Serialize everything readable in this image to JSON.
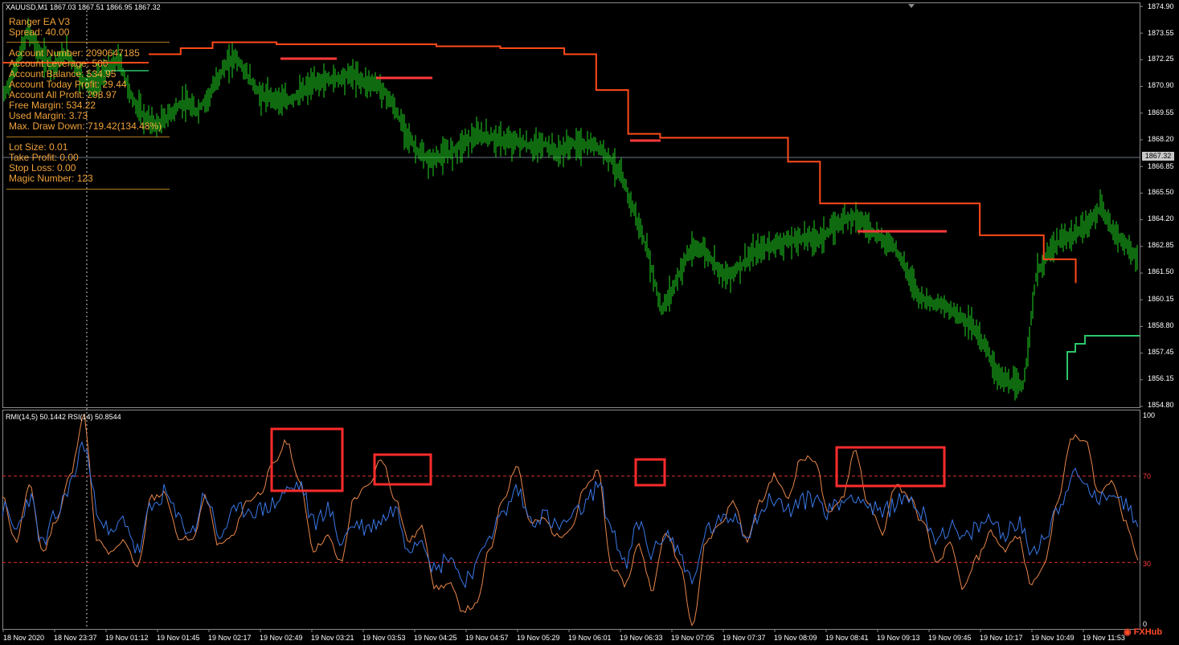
{
  "header": {
    "symbol_quote": "XAUUSD,M1  1867.03 1867.51 1866.95 1867.32",
    "indicator_legend": "RMI(14,5) 50.1442  RSI(14) 50.8544"
  },
  "ea_panel": {
    "title": "Ranger EA V3",
    "spread": "Spread: 40.00",
    "account_number": "Account Number: 2090647185",
    "account_leverage": "Account Leverage: 500",
    "account_balance": "Account Balance: 534.95",
    "account_today_profit": "Account Today Profit: 29.44",
    "account_all_profit": "Account All Profit: 298.97",
    "free_margin": "Free Margin: 534.22",
    "used_margin": "Used Margin: 3.73",
    "max_draw_down": "Max. Draw Down: 719.42(134.48%)",
    "lot_size": "Lot Size: 0.01",
    "take_profit": "Take Profit: 0.00",
    "stop_loss": "Stop Loss: 0.00",
    "magic_number": "Magic Number: 123"
  },
  "price_axis": [
    "1874.90",
    "1873.55",
    "1872.25",
    "1870.90",
    "1869.55",
    "1868.20",
    "1866.85",
    "1865.50",
    "1864.20",
    "1862.85",
    "1861.50",
    "1860.15",
    "1858.80",
    "1857.45",
    "1856.15",
    "1854.80"
  ],
  "current_price_tag": "1867.32",
  "indicator_axis": {
    "max": "100",
    "upper": "70",
    "lower": "30",
    "min": "0"
  },
  "time_axis": [
    "18 Nov 2020",
    "18 Nov 23:37",
    "19 Nov 01:12",
    "19 Nov 01:45",
    "19 Nov 02:17",
    "19 Nov 02:49",
    "19 Nov 03:21",
    "19 Nov 03:53",
    "19 Nov 04:25",
    "19 Nov 04:57",
    "19 Nov 05:29",
    "19 Nov 06:01",
    "19 Nov 06:33",
    "19 Nov 07:05",
    "19 Nov 07:37",
    "19 Nov 08:09",
    "19 Nov 08:41",
    "19 Nov 09:13",
    "19 Nov 09:45",
    "19 Nov 10:17",
    "19 Nov 10:49",
    "19 Nov 11:53"
  ],
  "watermark": "FXHub",
  "colors": {
    "background": "#000000",
    "candles": "#1fd41f",
    "stop_line_orange": "#ff4a1a",
    "stop_line_green": "#2ec56a",
    "rsi_line": "#e8864a",
    "rmi_line": "#3a78e8",
    "level_line": "#e03030",
    "highlight_box": "#ff2b2b",
    "text_panel": "#f0a23a"
  },
  "chart_data": [
    {
      "type": "line",
      "title": "XAUUSD,M1",
      "ylim": [
        1854.8,
        1874.9
      ],
      "series": [
        {
          "name": "XAUUSD",
          "values": [
            1870.2,
            1871.8,
            1873.7,
            1872.4,
            1871.9,
            1872.6,
            1871.4,
            1870.9,
            1871.6,
            1872.3,
            1870.3,
            1869.3,
            1868.9,
            1869.5,
            1870.1,
            1869.6,
            1870.4,
            1871.7,
            1872.4,
            1871.4,
            1870.4,
            1870.3,
            1870.1,
            1870.5,
            1871.0,
            1871.2,
            1871.3,
            1871.5,
            1871.1,
            1871.0,
            1870.2,
            1868.9,
            1867.7,
            1867.1,
            1867.4,
            1867.7,
            1868.2,
            1868.4,
            1868.3,
            1868.1,
            1868.1,
            1867.8,
            1868.0,
            1867.5,
            1868.0,
            1867.9,
            1867.9,
            1867.3,
            1866.2,
            1864.4,
            1862.4,
            1859.6,
            1860.9,
            1862.4,
            1862.8,
            1862.1,
            1861.3,
            1861.8,
            1862.4,
            1862.8,
            1863.0,
            1863.1,
            1863.3,
            1863.2,
            1863.6,
            1864.2,
            1864.4,
            1863.8,
            1863.2,
            1862.9,
            1861.6,
            1860.3,
            1860.0,
            1859.8,
            1859.4,
            1858.9,
            1857.9,
            1856.4,
            1855.9,
            1855.8,
            1861.4,
            1862.6,
            1863.2,
            1863.4,
            1864.0,
            1864.8,
            1863.6,
            1862.9,
            1862.0
          ]
        },
        {
          "name": "Stop Line",
          "values": [
            1872.5,
            1872.8,
            1873.1,
            1873.1,
            1873.0,
            1873.0,
            1873.0,
            1873.0,
            1873.0,
            1872.9,
            1872.9,
            1872.8,
            1872.8,
            1872.5,
            1870.7,
            1868.5,
            1868.3,
            1868.3,
            1868.3,
            1868.3,
            1867.1,
            1865.0,
            1865.0,
            1865.0,
            1865.0,
            1865.0,
            1863.4,
            1863.4,
            1862.2,
            1861.0,
            1858.6,
            1858.6
          ]
        }
      ]
    },
    {
      "type": "line",
      "title": "RMI(14,5) RSI(14)",
      "ylim": [
        0,
        100
      ],
      "series": [
        {
          "name": "RMI(14,5)",
          "values": [
            55,
            45,
            60,
            38,
            52,
            66,
            85,
            55,
            42,
            50,
            35,
            55,
            62,
            50,
            44,
            62,
            42,
            52,
            55,
            54,
            57,
            63,
            66,
            48,
            55,
            40,
            48,
            46,
            50,
            55,
            38,
            42,
            26,
            34,
            22,
            28,
            44,
            52,
            64,
            50,
            52,
            46,
            50,
            56,
            66,
            46,
            28,
            48,
            34,
            44,
            35,
            20,
            45,
            48,
            52,
            44,
            54,
            60,
            54,
            58,
            60,
            54,
            58,
            62,
            56,
            52,
            58,
            60,
            52,
            42,
            46,
            40,
            46,
            50,
            44,
            48,
            36,
            42,
            56,
            70,
            66,
            58,
            64,
            56,
            50
          ]
        },
        {
          "name": "RSI(14)",
          "values": [
            60,
            40,
            65,
            35,
            50,
            70,
            98,
            40,
            34,
            40,
            28,
            60,
            62,
            42,
            40,
            60,
            38,
            42,
            58,
            62,
            75,
            86,
            66,
            36,
            42,
            30,
            60,
            65,
            78,
            60,
            40,
            46,
            18,
            20,
            8,
            10,
            36,
            60,
            75,
            48,
            50,
            42,
            46,
            64,
            72,
            28,
            20,
            38,
            18,
            44,
            30,
            2,
            40,
            48,
            58,
            40,
            58,
            70,
            60,
            78,
            78,
            52,
            60,
            82,
            56,
            44,
            66,
            60,
            48,
            30,
            38,
            18,
            32,
            44,
            36,
            42,
            20,
            30,
            60,
            88,
            86,
            62,
            68,
            48,
            30
          ]
        }
      ]
    }
  ]
}
